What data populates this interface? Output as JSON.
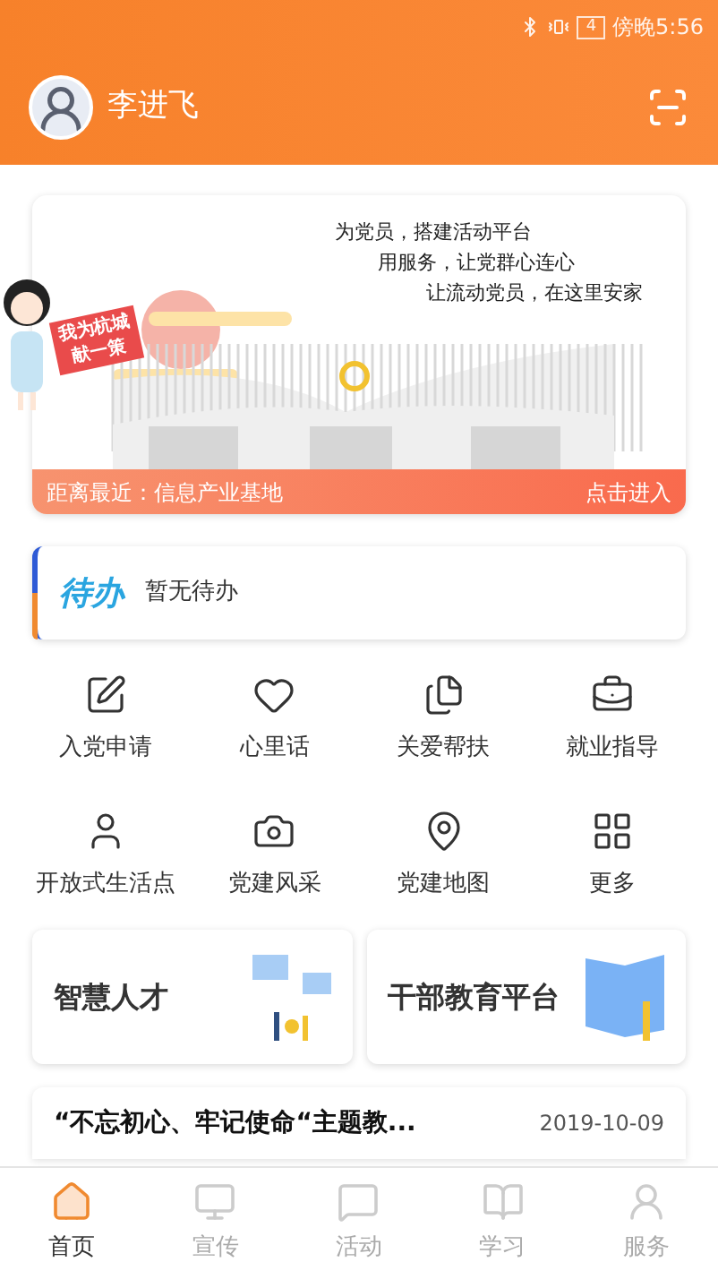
{
  "status_bar": {
    "battery": "4",
    "time": "傍晚5:56"
  },
  "header": {
    "user_name": "李进飞"
  },
  "banner": {
    "slogans": [
      "为党员，搭建活动平台",
      "用服务，让党群心连心",
      "让流动党员，在这里安家"
    ],
    "sign_lines": [
      "我为杭城",
      "献一策"
    ],
    "footer_left": "距离最近：信息产业基地",
    "footer_right": "点击进入"
  },
  "todo": {
    "badge": "待办",
    "text": "暂无待办"
  },
  "shortcuts": [
    {
      "label": "入党申请"
    },
    {
      "label": "心里话"
    },
    {
      "label": "关爱帮扶"
    },
    {
      "label": "就业指导"
    },
    {
      "label": "开放式生活点"
    },
    {
      "label": "党建风采"
    },
    {
      "label": "党建地图"
    },
    {
      "label": "更多"
    }
  ],
  "feature_cards": [
    {
      "title": "智慧人才"
    },
    {
      "title": "干部教育平台"
    }
  ],
  "news": [
    {
      "title": "“不忘初心、牢记使命“主题教...",
      "date": "2019-10-09"
    }
  ],
  "tabs": [
    {
      "label": "首页",
      "selected": true
    },
    {
      "label": "宣传",
      "selected": false
    },
    {
      "label": "活动",
      "selected": false
    },
    {
      "label": "学习",
      "selected": false
    },
    {
      "label": "服务",
      "selected": false
    }
  ]
}
